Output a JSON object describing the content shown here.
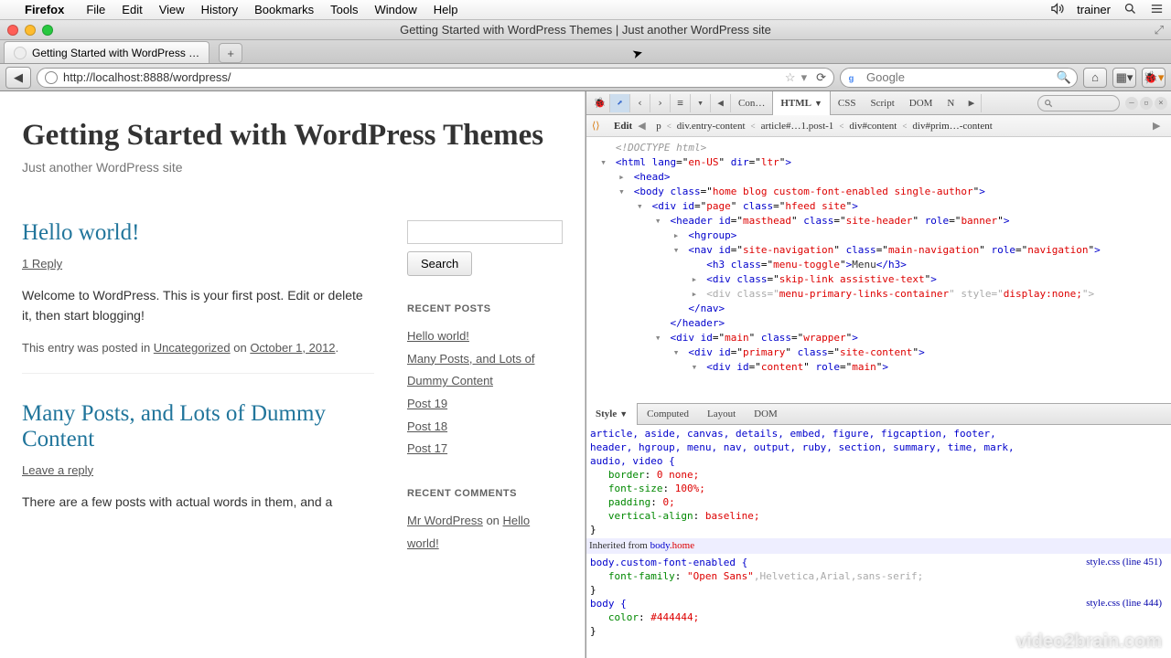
{
  "menubar": {
    "app": "Firefox",
    "items": [
      "File",
      "Edit",
      "View",
      "History",
      "Bookmarks",
      "Tools",
      "Window",
      "Help"
    ],
    "user": "trainer"
  },
  "window": {
    "title": "Getting Started with WordPress Themes | Just another WordPress site",
    "tab": "Getting Started with WordPress …"
  },
  "urlbar": {
    "url": "http://localhost:8888/wordpress/",
    "search_placeholder": "Google"
  },
  "page": {
    "site_title": "Getting Started with WordPress Themes",
    "tagline": "Just another WordPress site",
    "posts": [
      {
        "title": "Hello world!",
        "replies": "1 Reply",
        "body": "Welcome to WordPress. This is your first post. Edit or delete it, then start blogging!",
        "meta_pre": "This entry was posted in ",
        "cat": "Uncategorized",
        "meta_on": " on ",
        "date": "October 1, 2012"
      },
      {
        "title": "Many Posts, and Lots of Dummy Content",
        "replies": "Leave a reply",
        "body": "There are a few posts with actual words in them, and a"
      }
    ],
    "sidebar": {
      "search_btn": "Search",
      "recent_posts_h": "RECENT POSTS",
      "recent_posts": [
        "Hello world!",
        "Many Posts, and Lots of Dummy Content",
        "Post 19",
        "Post 18",
        "Post 17"
      ],
      "recent_comments_h": "RECENT COMMENTS",
      "rc_author": "Mr WordPress",
      "rc_on": " on ",
      "rc_post": "Hello world!"
    }
  },
  "firebug": {
    "tabs": [
      "Con…",
      "HTML",
      "CSS",
      "Script",
      "DOM",
      "N"
    ],
    "active_tab": "HTML",
    "crumb": [
      "Edit",
      "p",
      "div.entry-content",
      "article#…1.post-1",
      "div#content",
      "div#prim…-content"
    ],
    "dom_lines": [
      {
        "ind": 0,
        "tw": "",
        "html": "<span class='c-doctype'>&lt;!DOCTYPE html&gt;</span>"
      },
      {
        "ind": 0,
        "tw": "▾",
        "html": "<span class='c-tag'>&lt;html</span> <span class='c-attr'>lang</span>=\"<span class='c-val'>en-US</span>\" <span class='c-attr'>dir</span>=\"<span class='c-val'>ltr</span>\"<span class='c-tag'>&gt;</span>"
      },
      {
        "ind": 1,
        "tw": "▸",
        "html": "<span class='c-tag'>&lt;head&gt;</span>"
      },
      {
        "ind": 1,
        "tw": "▾",
        "html": "<span class='c-tag'>&lt;body</span> <span class='c-attr'>class</span>=\"<span class='c-val'>home blog custom-font-enabled single-author</span>\"<span class='c-tag'>&gt;</span>"
      },
      {
        "ind": 2,
        "tw": "▾",
        "html": "<span class='c-tag'>&lt;div</span> <span class='c-attr'>id</span>=\"<span class='c-val'>page</span>\" <span class='c-attr'>class</span>=\"<span class='c-val'>hfeed site</span>\"<span class='c-tag'>&gt;</span>"
      },
      {
        "ind": 3,
        "tw": "▾",
        "html": "<span class='c-tag'>&lt;header</span> <span class='c-attr'>id</span>=\"<span class='c-val'>masthead</span>\" <span class='c-attr'>class</span>=\"<span class='c-val'>site-header</span>\" <span class='c-attr'>role</span>=\"<span class='c-val'>banner</span>\"<span class='c-tag'>&gt;</span>"
      },
      {
        "ind": 4,
        "tw": "▸",
        "html": "<span class='c-tag'>&lt;hgroup&gt;</span>"
      },
      {
        "ind": 4,
        "tw": "▾",
        "html": "<span class='c-tag'>&lt;nav</span> <span class='c-attr'>id</span>=\"<span class='c-val'>site-navigation</span>\" <span class='c-attr'>class</span>=\"<span class='c-val'>main-navigation</span>\" <span class='c-attr'>role</span>=\"<span class='c-val'>navigation</span>\"<span class='c-tag'>&gt;</span>"
      },
      {
        "ind": 5,
        "tw": "",
        "html": "<span class='c-tag'>&lt;h3</span> <span class='c-attr'>class</span>=\"<span class='c-val'>menu-toggle</span>\"<span class='c-tag'>&gt;</span><span class='c-text'>Menu</span><span class='c-tag'>&lt;/h3&gt;</span>"
      },
      {
        "ind": 5,
        "tw": "▸",
        "html": "<span class='c-tag'>&lt;div</span> <span class='c-attr'>class</span>=\"<span class='c-val'>skip-link assistive-text</span>\"<span class='c-tag'>&gt;</span>"
      },
      {
        "ind": 5,
        "tw": "▸",
        "html": "<span class='grey'>&lt;div class=\"</span><span class='c-val'>menu-primary-links-container</span><span class='grey'>\" style=\"</span><span class='c-val'>display:none;</span><span class='grey'>\"&gt;</span>"
      },
      {
        "ind": 4,
        "tw": "",
        "html": "<span class='c-tag'>&lt;/nav&gt;</span>"
      },
      {
        "ind": 3,
        "tw": "",
        "html": "<span class='c-tag'>&lt;/header&gt;</span>"
      },
      {
        "ind": 3,
        "tw": "▾",
        "html": "<span class='c-tag'>&lt;div</span> <span class='c-attr'>id</span>=\"<span class='c-val'>main</span>\" <span class='c-attr'>class</span>=\"<span class='c-val'>wrapper</span>\"<span class='c-tag'>&gt;</span>"
      },
      {
        "ind": 4,
        "tw": "▾",
        "html": "<span class='c-tag'>&lt;div</span> <span class='c-attr'>id</span>=\"<span class='c-val'>primary</span>\" <span class='c-attr'>class</span>=\"<span class='c-val'>site-content</span>\"<span class='c-tag'>&gt;</span>"
      },
      {
        "ind": 5,
        "tw": "▾",
        "html": "<span class='c-tag'>&lt;div</span> <span class='c-attr'>id</span>=\"<span class='c-val'>content</span>\" <span class='c-attr'>role</span>=\"<span class='c-val'>main</span>\"<span class='c-tag'>&gt;</span>"
      }
    ],
    "subtabs": [
      "Style",
      "Computed",
      "Layout",
      "DOM"
    ],
    "style_block1_sel": "article, aside, canvas, details, embed, figure, figcaption, footer,\nheader, hgroup, menu, nav, output, ruby, section, summary, time, mark,\naudio, video {",
    "style_block1_props": [
      [
        "border",
        "0 none;"
      ],
      [
        "font-size",
        "100%;"
      ],
      [
        "padding",
        "0;"
      ],
      [
        "vertical-align",
        "baseline;"
      ]
    ],
    "inherited": "Inherited from ",
    "inherited_sel": "body",
    "inherited_cls": ".home",
    "style_block2_sel": "body.custom-font-enabled {",
    "style_block2_src": "style.css (line 451)",
    "style_block2_props": [
      [
        "font-family",
        "\"Open Sans\""
      ]
    ],
    "style_block2_extra": ",Helvetica,Arial,sans-serif;",
    "style_block3_sel": "body {",
    "style_block3_src": "style.css (line 444)",
    "style_block3_props": [
      [
        "color",
        "#444444;"
      ]
    ]
  },
  "watermark": "video2brain.com"
}
